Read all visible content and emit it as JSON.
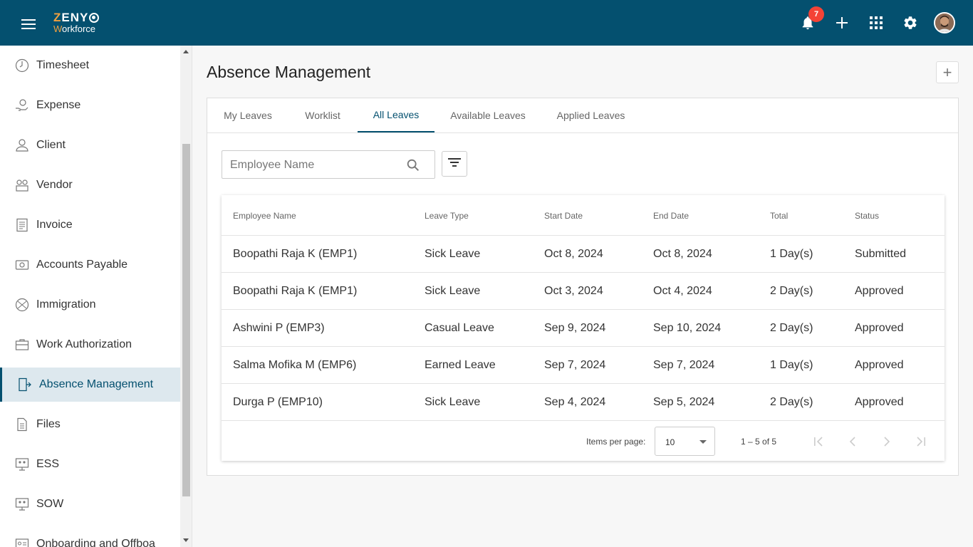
{
  "brand": {
    "logo_top_a": "Z",
    "logo_top_b": "ENY",
    "logo_bottom_a": "W",
    "logo_bottom_b": "orkforce",
    "color": "#04506f"
  },
  "topbar": {
    "notification_count": "7"
  },
  "sidebar": {
    "items": [
      {
        "label": "Timesheet",
        "icon": "clock-icon"
      },
      {
        "label": "Expense",
        "icon": "money-hand-icon"
      },
      {
        "label": "Client",
        "icon": "person-icon"
      },
      {
        "label": "Vendor",
        "icon": "vendor-icon"
      },
      {
        "label": "Invoice",
        "icon": "document-icon"
      },
      {
        "label": "Accounts Payable",
        "icon": "payable-icon"
      },
      {
        "label": "Immigration",
        "icon": "globe-icon"
      },
      {
        "label": "Work Authorization",
        "icon": "briefcase-icon"
      },
      {
        "label": "Absence Management",
        "icon": "door-exit-icon",
        "active": true
      },
      {
        "label": "Files",
        "icon": "file-icon"
      },
      {
        "label": "ESS",
        "icon": "monitor-people-icon"
      },
      {
        "label": "SOW",
        "icon": "monitor-people-icon"
      },
      {
        "label": "Onboarding and Offboa",
        "icon": "id-card-icon"
      }
    ]
  },
  "main": {
    "title": "Absence Management",
    "tabs": [
      "My Leaves",
      "Worklist",
      "All Leaves",
      "Available Leaves",
      "Applied Leaves"
    ],
    "active_tab": "All Leaves",
    "search": {
      "placeholder": "Employee Name",
      "value": ""
    },
    "table": {
      "columns": [
        "Employee Name",
        "Leave Type",
        "Start Date",
        "End Date",
        "Total",
        "Status"
      ],
      "rows": [
        [
          "Boopathi Raja K (EMP1)",
          "Sick Leave",
          "Oct 8, 2024",
          "Oct 8, 2024",
          "1 Day(s)",
          "Submitted"
        ],
        [
          "Boopathi Raja K (EMP1)",
          "Sick Leave",
          "Oct 3, 2024",
          "Oct 4, 2024",
          "2 Day(s)",
          "Approved"
        ],
        [
          "Ashwini P (EMP3)",
          "Casual Leave",
          "Sep 9, 2024",
          "Sep 10, 2024",
          "2 Day(s)",
          "Approved"
        ],
        [
          "Salma Mofika M (EMP6)",
          "Earned Leave",
          "Sep 7, 2024",
          "Sep 7, 2024",
          "1 Day(s)",
          "Approved"
        ],
        [
          "Durga P (EMP10)",
          "Sick Leave",
          "Sep 4, 2024",
          "Sep 5, 2024",
          "2 Day(s)",
          "Approved"
        ]
      ]
    },
    "paginator": {
      "items_per_page_label": "Items per page:",
      "items_per_page": "10",
      "range": "1 – 5 of 5"
    }
  }
}
